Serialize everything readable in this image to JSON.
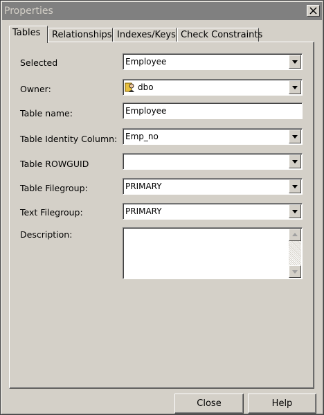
{
  "window": {
    "title": "Properties"
  },
  "tabs": [
    {
      "label": "Tables",
      "active": true
    },
    {
      "label": "Relationships",
      "active": false
    },
    {
      "label": "Indexes/Keys",
      "active": false
    },
    {
      "label": "Check Constraints",
      "active": false
    }
  ],
  "form": {
    "selected": {
      "label": "Selected",
      "value": "Employee"
    },
    "owner": {
      "label": "Owner:",
      "value": "dbo",
      "icon": "user-icon"
    },
    "table_name": {
      "label": "Table name:",
      "value": "Employee"
    },
    "identity_column": {
      "label": "Table Identity Column:",
      "value": "Emp_no"
    },
    "rowguid": {
      "label": "Table ROWGUID",
      "value": ""
    },
    "table_filegroup": {
      "label": "Table Filegroup:",
      "value": "PRIMARY"
    },
    "text_filegroup": {
      "label": "Text Filegroup:",
      "value": "PRIMARY"
    },
    "description": {
      "label": "Description:",
      "value": ""
    }
  },
  "buttons": {
    "close": "Close",
    "help": "Help"
  }
}
